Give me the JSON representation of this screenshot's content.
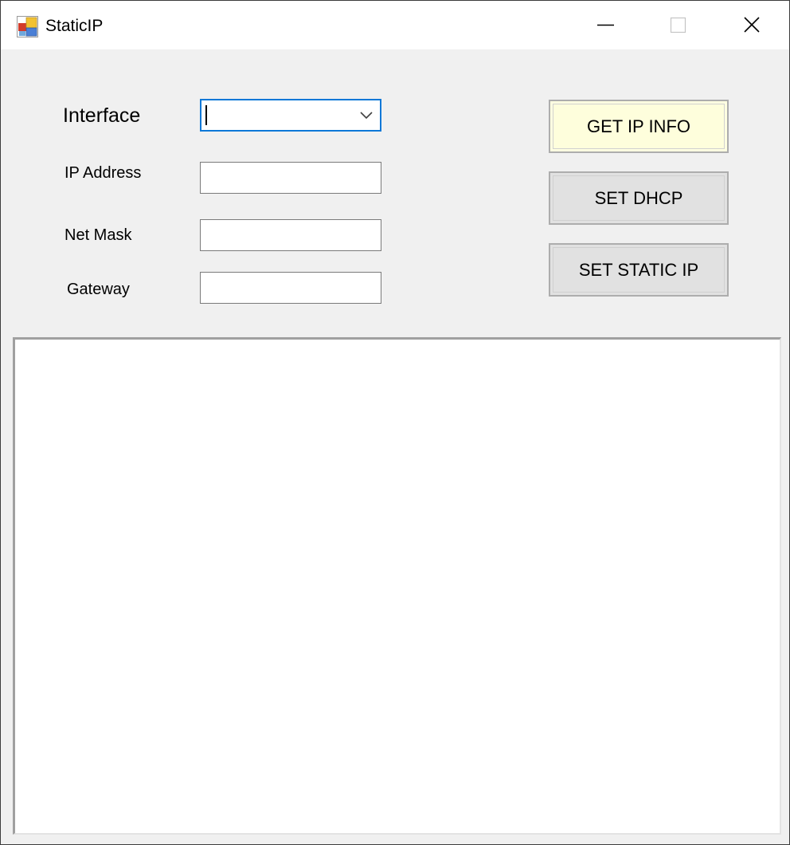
{
  "window": {
    "title": "StaticIP",
    "controls": {
      "minimize": "minimize",
      "maximize": "maximize",
      "close": "close"
    }
  },
  "form": {
    "interface_label": "Interface",
    "interface_value": "",
    "ip_address_label": "IP Address",
    "ip_address_value": "",
    "net_mask_label": "Net Mask",
    "net_mask_value": "",
    "gateway_label": "Gateway",
    "gateway_value": ""
  },
  "buttons": {
    "get_ip_info": "GET IP INFO",
    "set_dhcp": "SET DHCP",
    "set_static_ip": "SET STATIC IP"
  },
  "output": {
    "text": ""
  },
  "colors": {
    "focus_border": "#0a78d7",
    "default_button_bg": "#ffffe1",
    "button_bg": "#e1e1e1",
    "client_bg": "#f0f0f0"
  },
  "icons": {
    "app": "app-icon",
    "dropdown": "chevron-down-icon",
    "minimize": "minimize-icon",
    "maximize": "maximize-icon",
    "close": "close-icon"
  }
}
